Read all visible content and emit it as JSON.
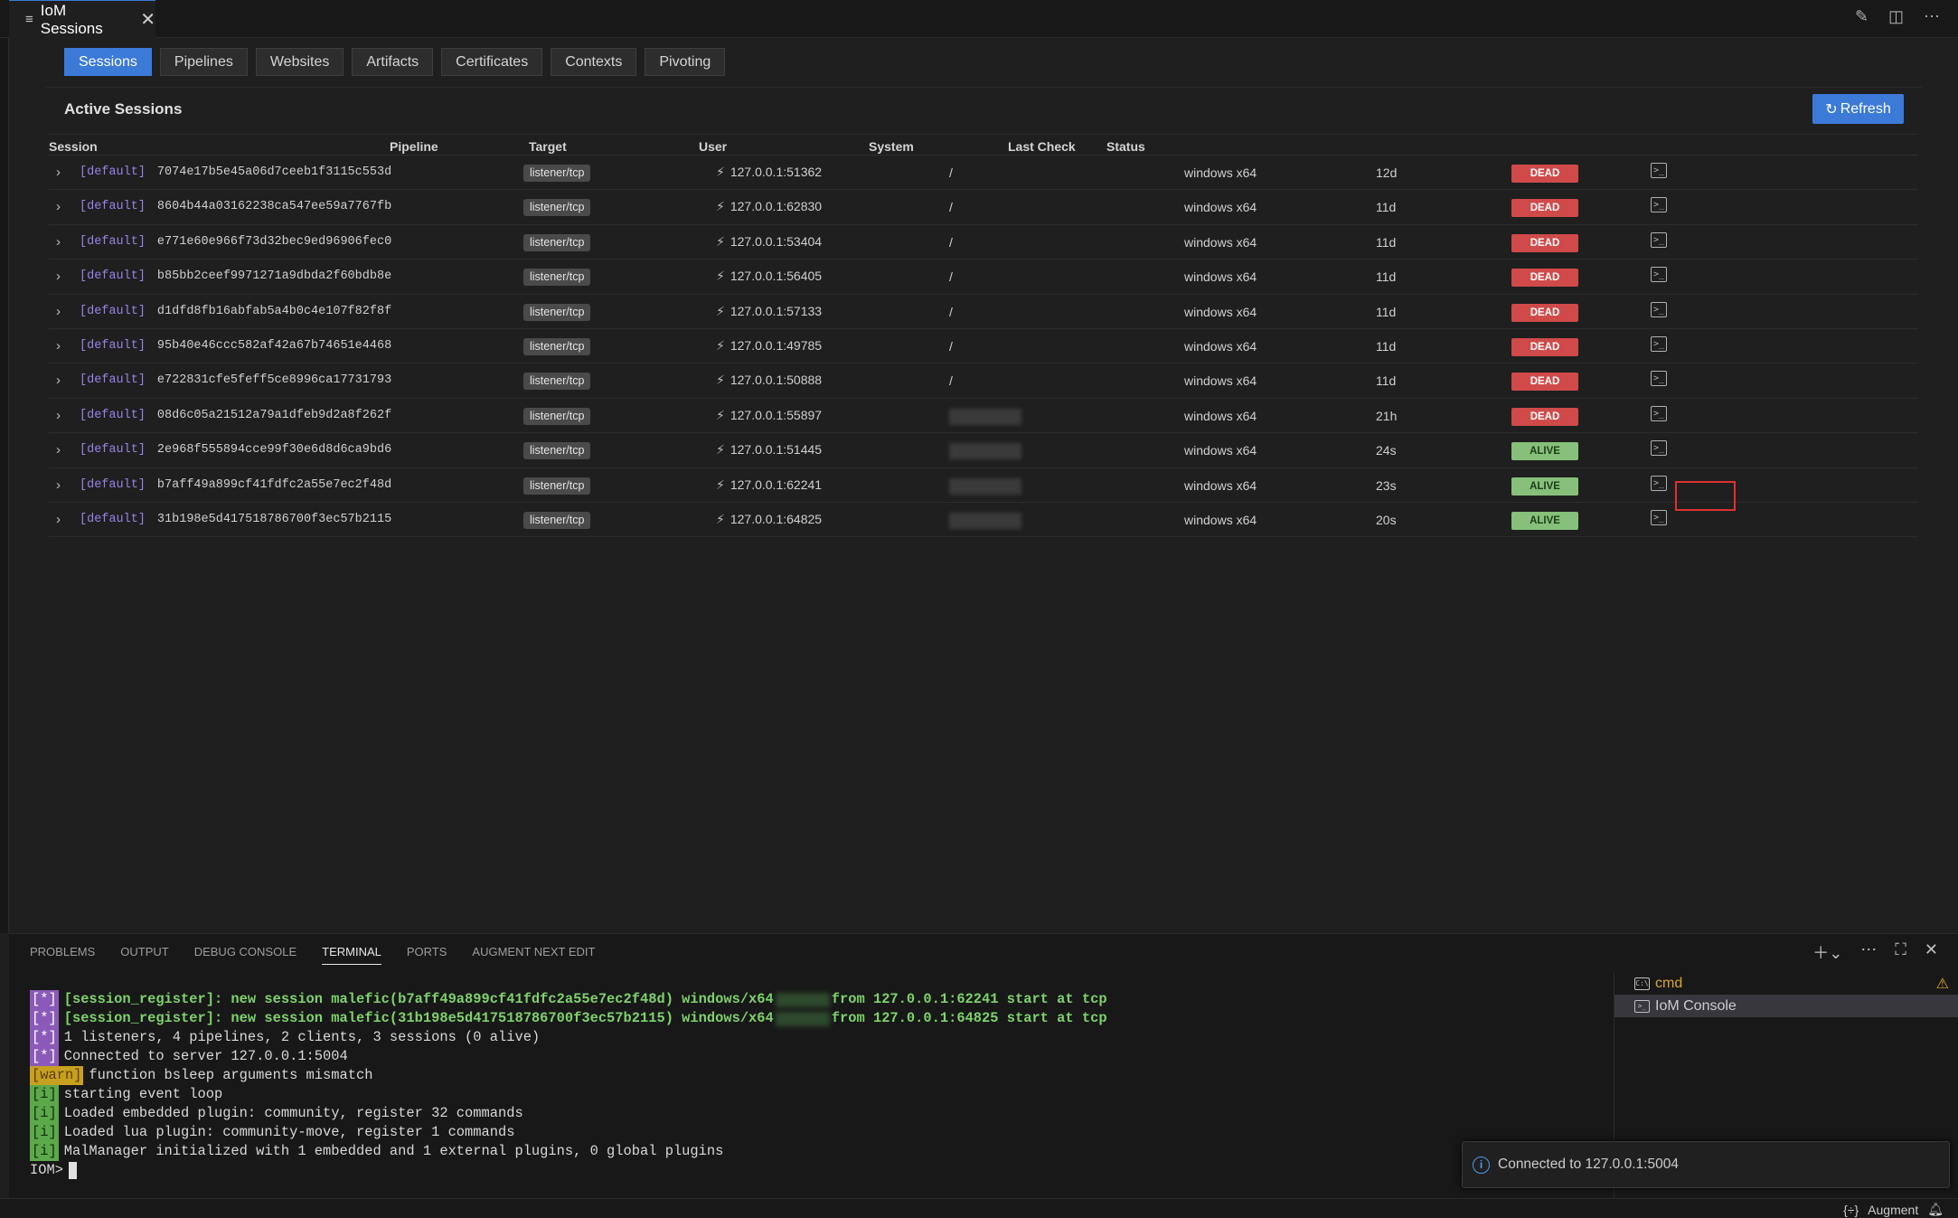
{
  "tab": {
    "title": "IoM Sessions",
    "close": "✕"
  },
  "nav": {
    "buttons": [
      "Sessions",
      "Pipelines",
      "Websites",
      "Artifacts",
      "Certificates",
      "Contexts",
      "Pivoting"
    ],
    "active": "Sessions"
  },
  "section_title": "Active Sessions",
  "refresh_label": "Refresh",
  "table": {
    "headers": [
      "Session",
      "Pipeline",
      "Target",
      "User",
      "System",
      "Last Check",
      "Status"
    ],
    "rows": [
      {
        "group": "[default]",
        "id": "7074e17b5e45a06d7ceeb1f3115c553d",
        "pipeline": "listener/tcp",
        "target": "127.0.0.1:51362",
        "user": "/",
        "system": "windows x64",
        "last": "12d",
        "status": "DEAD"
      },
      {
        "group": "[default]",
        "id": "8604b44a03162238ca547ee59a7767fb",
        "pipeline": "listener/tcp",
        "target": "127.0.0.1:62830",
        "user": "/",
        "system": "windows x64",
        "last": "11d",
        "status": "DEAD"
      },
      {
        "group": "[default]",
        "id": "e771e60e966f73d32bec9ed96906fec0",
        "pipeline": "listener/tcp",
        "target": "127.0.0.1:53404",
        "user": "/",
        "system": "windows x64",
        "last": "11d",
        "status": "DEAD"
      },
      {
        "group": "[default]",
        "id": "b85bb2ceef9971271a9dbda2f60bdb8e",
        "pipeline": "listener/tcp",
        "target": "127.0.0.1:56405",
        "user": "/",
        "system": "windows x64",
        "last": "11d",
        "status": "DEAD"
      },
      {
        "group": "[default]",
        "id": "d1dfd8fb16abfab5a4b0c4e107f82f8f",
        "pipeline": "listener/tcp",
        "target": "127.0.0.1:57133",
        "user": "/",
        "system": "windows x64",
        "last": "11d",
        "status": "DEAD"
      },
      {
        "group": "[default]",
        "id": "95b40e46ccc582af42a67b74651e4468",
        "pipeline": "listener/tcp",
        "target": "127.0.0.1:49785",
        "user": "/",
        "system": "windows x64",
        "last": "11d",
        "status": "DEAD"
      },
      {
        "group": "[default]",
        "id": "e722831cfe5feff5ce8996ca17731793",
        "pipeline": "listener/tcp",
        "target": "127.0.0.1:50888",
        "user": "/",
        "system": "windows x64",
        "last": "11d",
        "status": "DEAD"
      },
      {
        "group": "[default]",
        "id": "08d6c05a21512a79a1dfeb9d2a8f262f",
        "pipeline": "listener/tcp",
        "target": "127.0.0.1:55897",
        "user": "",
        "system": "windows x64",
        "last": "21h",
        "status": "DEAD"
      },
      {
        "group": "[default]",
        "id": "2e968f555894cce99f30e6d8d6ca9bd6",
        "pipeline": "listener/tcp",
        "target": "127.0.0.1:51445",
        "user": "",
        "system": "windows x64",
        "last": "24s",
        "status": "ALIVE"
      },
      {
        "group": "[default]",
        "id": "b7aff49a899cf41fdfc2a55e7ec2f48d",
        "pipeline": "listener/tcp",
        "target": "127.0.0.1:62241",
        "user": "",
        "system": "windows x64",
        "last": "23s",
        "status": "ALIVE"
      },
      {
        "group": "[default]",
        "id": "31b198e5d417518786700f3ec57b2115",
        "pipeline": "listener/tcp",
        "target": "127.0.0.1:64825",
        "user": "",
        "system": "windows x64",
        "last": "20s",
        "status": "ALIVE"
      }
    ]
  },
  "bottom": {
    "tabs": [
      "PROBLEMS",
      "OUTPUT",
      "DEBUG CONSOLE",
      "TERMINAL",
      "PORTS",
      "AUGMENT NEXT EDIT"
    ],
    "active_tab": "TERMINAL",
    "terminal_lines": [
      {
        "prefix": "[*]",
        "kind": "star",
        "bold": true,
        "text": "[session_register]: new session malefic(b7aff49a899cf41fdfc2a55e7ec2f48d) windows/x64",
        "tail": "from 127.0.0.1:62241 start at tcp",
        "redacted": true
      },
      {
        "prefix": "[*]",
        "kind": "star",
        "bold": true,
        "text": "[session_register]: new session malefic(31b198e5d417518786700f3ec57b2115) windows/x64",
        "tail": "from 127.0.0.1:64825 start at tcp",
        "redacted": true
      },
      {
        "prefix": "[*]",
        "kind": "star",
        "bold": false,
        "text": "1 listeners, 4 pipelines, 2 clients, 3 sessions (0 alive)",
        "tail": "",
        "redacted": false
      },
      {
        "prefix": "[*]",
        "kind": "star",
        "bold": false,
        "text": "Connected to server 127.0.0.1:5004",
        "tail": "",
        "redacted": false
      },
      {
        "prefix": "[warn]",
        "kind": "warn",
        "bold": false,
        "text": "function bsleep arguments mismatch",
        "tail": "",
        "redacted": false
      },
      {
        "prefix": "[i]",
        "kind": "info",
        "bold": false,
        "text": "starting event loop",
        "tail": "",
        "redacted": false
      },
      {
        "prefix": "[i]",
        "kind": "info",
        "bold": false,
        "text": "Loaded embedded plugin: community, register 32 commands",
        "tail": "",
        "redacted": false
      },
      {
        "prefix": "[i]",
        "kind": "info",
        "bold": false,
        "text": "Loaded lua plugin: community-move, register 1 commands",
        "tail": "",
        "redacted": false
      },
      {
        "prefix": "[i]",
        "kind": "info",
        "bold": false,
        "text": "MalManager initialized with 1 embedded and 1 external plugins, 0 global plugins",
        "tail": "",
        "redacted": false
      }
    ],
    "prompt": "IOM>",
    "terminals": [
      "cmd",
      "IoM Console"
    ],
    "active_terminal": "IoM Console"
  },
  "toast": "Connected to 127.0.0.1:5004",
  "statusbar": {
    "augment": "Augment"
  },
  "highlight_row_index": 8
}
